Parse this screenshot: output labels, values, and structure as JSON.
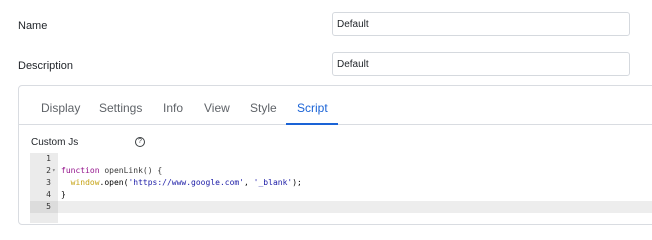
{
  "form": {
    "name_label": "Name",
    "name_value": "Default",
    "description_label": "Description",
    "description_value": "Default"
  },
  "tabs": [
    {
      "label": "Display"
    },
    {
      "label": "Settings"
    },
    {
      "label": "Info"
    },
    {
      "label": "View"
    },
    {
      "label": "Style"
    },
    {
      "label": "Script"
    }
  ],
  "active_tab": "Script",
  "custom_js": {
    "label": "Custom Js",
    "help_icon": "question-circle-icon",
    "line_numbers": [
      "1",
      "2",
      "3",
      "4",
      "5"
    ],
    "fold_marker": "▾",
    "code": {
      "line2_kw": "function",
      "line2_rest": " openLink() {",
      "line3_obj": "  window",
      "line3_mid": ".open(",
      "line3_str1": "'https://www.google.com'",
      "line3_sep": ", ",
      "line3_str2": "'_blank'",
      "line3_end": ");",
      "line4": "}"
    }
  },
  "colors": {
    "accent": "#1a63d6",
    "keyword": "#93118b",
    "string": "#1a1aa6"
  }
}
